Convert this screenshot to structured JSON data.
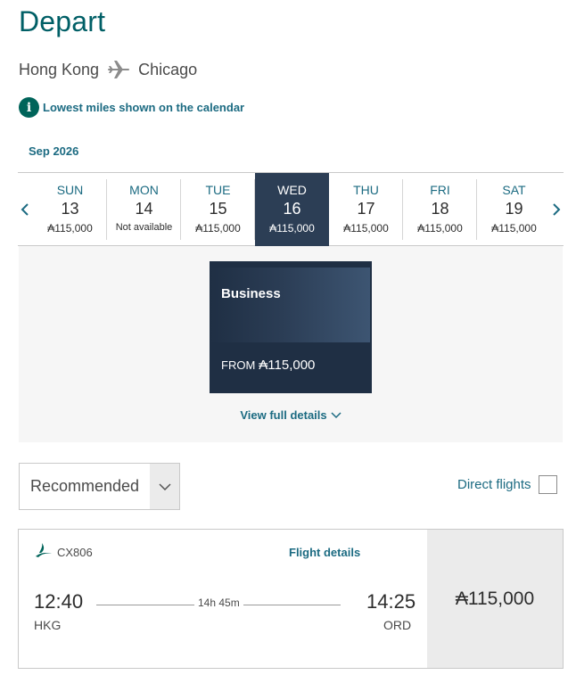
{
  "title": "Depart",
  "route": {
    "from": "Hong Kong",
    "to": "Chicago",
    "icon": "airplane-icon"
  },
  "info": {
    "icon": "info-icon",
    "text": "Lowest miles shown on the calendar"
  },
  "calendar": {
    "month": "Sep 2026",
    "prev_icon": "chevron-left-icon",
    "next_icon": "chevron-right-icon",
    "days": [
      {
        "dow": "SUN",
        "date": "13",
        "miles": "₳115,000",
        "selected": false
      },
      {
        "dow": "MON",
        "date": "14",
        "miles": "Not available",
        "selected": false
      },
      {
        "dow": "TUE",
        "date": "15",
        "miles": "₳115,000",
        "selected": false
      },
      {
        "dow": "WED",
        "date": "16",
        "miles": "₳115,000",
        "selected": true
      },
      {
        "dow": "THU",
        "date": "17",
        "miles": "₳115,000",
        "selected": false
      },
      {
        "dow": "FRI",
        "date": "18",
        "miles": "₳115,000",
        "selected": false
      },
      {
        "dow": "SAT",
        "date": "19",
        "miles": "₳115,000",
        "selected": false
      }
    ]
  },
  "cabin_card": {
    "cabin": "Business",
    "from_label": "FROM",
    "miles": "₳115,000"
  },
  "view_details": "View full details",
  "sort": {
    "value": "Recommended"
  },
  "direct_flights": {
    "label": "Direct flights",
    "checked": false
  },
  "flight": {
    "flight_no": "CX806",
    "details_link": "Flight details",
    "depart_time": "12:40",
    "depart_code": "HKG",
    "duration": "14h 45m",
    "arrive_time": "14:25",
    "arrive_code": "ORD",
    "price": "₳115,000"
  },
  "colors": {
    "brand": "#005f66",
    "link": "#1c6b82",
    "selected": "#2c3e55",
    "card": "#1f2f44"
  }
}
